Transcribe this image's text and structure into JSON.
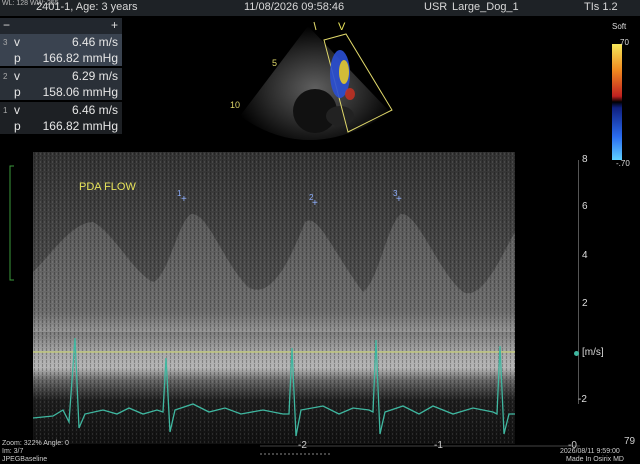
{
  "top_bar": {
    "wl_ww": "WL: 128 WW: 255",
    "patient": "2401-1, Age: 3 years",
    "datetime": "11/08/2026 09:58:46",
    "usr": "USR",
    "preset": "Large_Dog_1",
    "tis": "TIs 1.2"
  },
  "measurements": [
    {
      "index": "3",
      "label": "v",
      "value": "6.46 m/s"
    },
    {
      "index": "",
      "label": "p",
      "value": "166.82 mmHg"
    },
    {
      "index": "2",
      "label": "v",
      "value": "6.29 m/s"
    },
    {
      "index": "",
      "label": "p",
      "value": "158.06 mmHg"
    },
    {
      "index": "1",
      "label": "v",
      "value": "6.46 m/s"
    },
    {
      "index": "",
      "label": "p",
      "value": "166.82 mmHg"
    }
  ],
  "image_labels": {
    "v_marker": "V",
    "depth_5": "5",
    "depth_10": "10",
    "flow_label": "PDA FLOW",
    "cursor_1": "1",
    "cursor_2": "2",
    "cursor_3": "3"
  },
  "colorbar": {
    "title": "Soft",
    "top": "70",
    "bottom": "-.70"
  },
  "velocity_scale": {
    "ticks": [
      "8",
      "6",
      "4",
      "2",
      "-2"
    ],
    "unit": "[m/s]"
  },
  "time_axis": {
    "ticks": [
      "-2",
      "-1",
      "-0"
    ],
    "right_value": "79"
  },
  "footer": {
    "zoom": "Zoom: 322% Angle: 0",
    "im": "Im: 3/7",
    "compression": "JPEGBaseline",
    "viewer_date": "2026/08/11 9:59:00",
    "made_in": "Made In Osirix MD"
  },
  "colors": {
    "accent_yellow": "#e7e35a",
    "ecg_teal": "#3fb7a0",
    "baseline": "#c9d27a"
  }
}
